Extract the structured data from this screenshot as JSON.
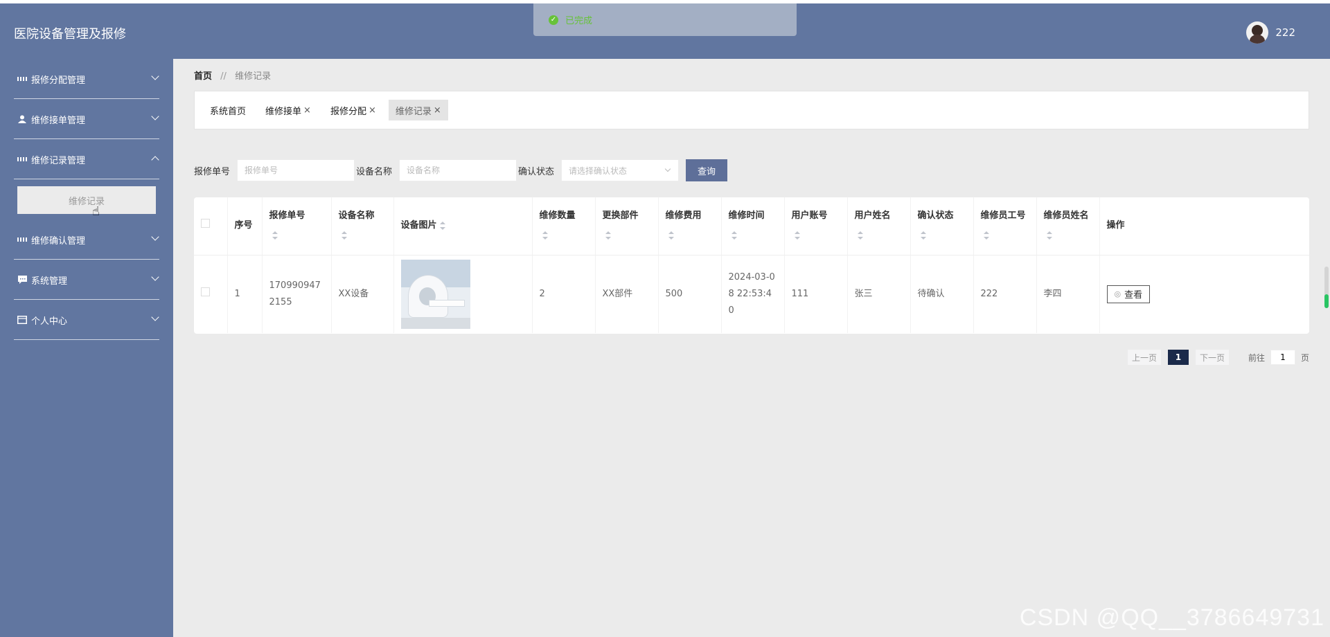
{
  "header": {
    "title": "医院设备管理及报修",
    "username": "222"
  },
  "toast": {
    "message": "已完成"
  },
  "sidebar": {
    "items": [
      {
        "label": "报修分配管理"
      },
      {
        "label": "维修接单管理"
      },
      {
        "label": "维修记录管理"
      },
      {
        "label": "维修确认管理"
      },
      {
        "label": "系统管理"
      },
      {
        "label": "个人中心"
      }
    ],
    "submenu_active": "维修记录"
  },
  "breadcrumb": {
    "home": "首页",
    "sep": "//",
    "current": "维修记录"
  },
  "tabs": [
    {
      "label": "系统首页"
    },
    {
      "label": "维修接单"
    },
    {
      "label": "报修分配"
    },
    {
      "label": "维修记录"
    }
  ],
  "search": {
    "order_label": "报修单号",
    "order_placeholder": "报修单号",
    "device_label": "设备名称",
    "device_placeholder": "设备名称",
    "status_label": "确认状态",
    "status_placeholder": "请选择确认状态",
    "query_button": "查询"
  },
  "table": {
    "headers": {
      "index": "序号",
      "order_no": "报修单号",
      "device_name": "设备名称",
      "device_image": "设备图片",
      "repair_qty": "维修数量",
      "parts": "更换部件",
      "cost": "维修费用",
      "time": "维修时间",
      "account": "用户账号",
      "user_name": "用户姓名",
      "status": "确认状态",
      "worker_id": "维修员工号",
      "worker_name": "维修员姓名",
      "action": "操作"
    },
    "rows": [
      {
        "index": "1",
        "order_no": "1709909472155",
        "device_name": "XX设备",
        "repair_qty": "2",
        "parts": "XX部件",
        "cost": "500",
        "time": "2024-03-08 22:53:40",
        "account": "111",
        "user_name": "张三",
        "status": "待确认",
        "worker_id": "222",
        "worker_name": "李四",
        "view_button": "查看"
      }
    ]
  },
  "pagination": {
    "prev": "上一页",
    "current": "1",
    "next": "下一页",
    "goto_label": "前往",
    "goto_value": "1",
    "page_suffix": "页"
  },
  "watermark": "CSDN @QQ__3786649731",
  "colors": {
    "primary": "#6176a0",
    "button": "#5e6f99",
    "success": "#67c23a"
  }
}
